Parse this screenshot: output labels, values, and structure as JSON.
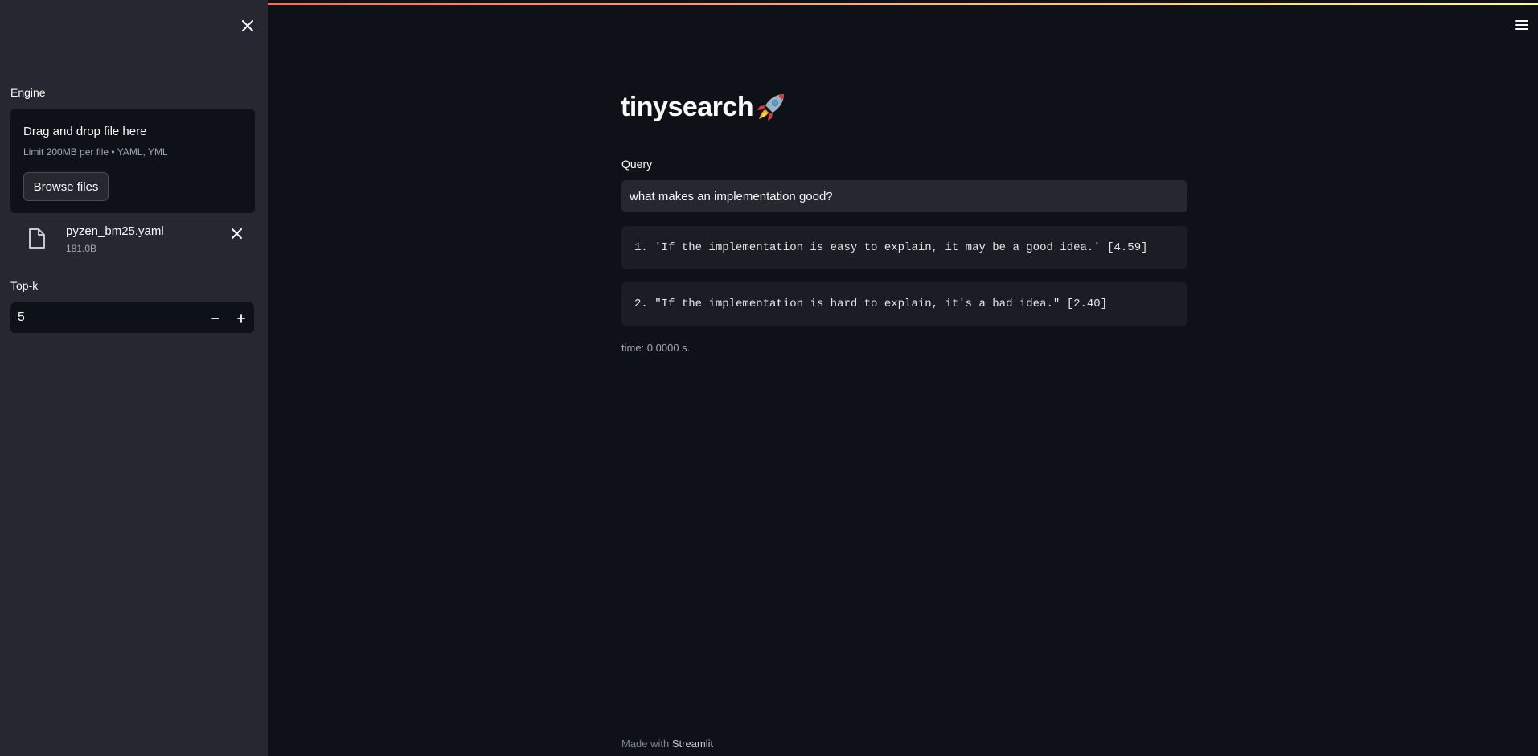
{
  "app": {
    "title": "tinysearch",
    "title_emoji": "rocket-icon"
  },
  "sidebar": {
    "engine_label": "Engine",
    "uploader": {
      "title": "Drag and drop file here",
      "limit": "Limit 200MB per file • YAML, YML",
      "browse_label": "Browse files"
    },
    "uploaded_file": {
      "name": "pyzen_bm25.yaml",
      "size": "181.0B"
    },
    "topk_label": "Top-k",
    "topk_value": "5"
  },
  "main": {
    "query_label": "Query",
    "query_value": "what makes an implementation good?",
    "results": [
      {
        "text": "1. 'If the implementation is easy to explain, it may be a good idea.' [4.59]"
      },
      {
        "text": "2. \"If the implementation is hard to explain, it's a bad idea.\" [2.40]"
      }
    ],
    "time_text": "time: 0.0000 s."
  },
  "footer": {
    "prefix": "Made with ",
    "link": "Streamlit"
  },
  "colors": {
    "background": "#0e1117",
    "sidebar": "#262730",
    "accent": "#ff4b4b"
  }
}
